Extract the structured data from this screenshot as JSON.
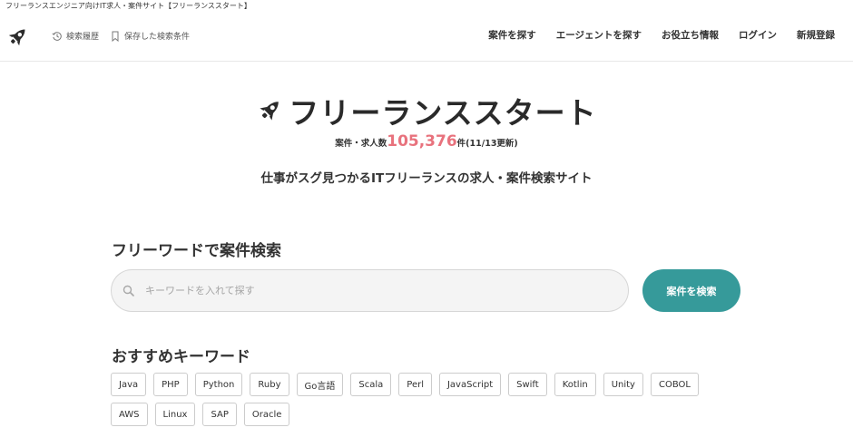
{
  "top_tagline": "フリーランスエンジニア向けIT求人・案件サイト【フリーランススタート】",
  "header": {
    "history_label": "検索履歴",
    "saved_label": "保存した検索条件",
    "nav": [
      "案件を探す",
      "エージェントを探す",
      "お役立ち情報",
      "ログイン",
      "新規登録"
    ]
  },
  "hero": {
    "brand_name": "フリーランススタート",
    "count_prefix": "案件・求人数",
    "count_value": "105,376",
    "count_suffix": "件(11/13更新)",
    "subtitle": "仕事がスグ見つかるITフリーランスの求人・案件検索サイト"
  },
  "search": {
    "section_title": "フリーワードで案件検索",
    "placeholder": "キーワードを入れて探す",
    "value": "",
    "button_label": "案件を検索"
  },
  "keywords": {
    "section_title": "おすすめキーワード",
    "row1": [
      "Java",
      "PHP",
      "Python",
      "Ruby",
      "Go言語",
      "Scala",
      "Perl",
      "JavaScript",
      "Swift",
      "Kotlin",
      "Unity",
      "COBOL"
    ],
    "row2": [
      "AWS",
      "Linux",
      "SAP",
      "Oracle"
    ]
  },
  "colors": {
    "accent_teal": "#369a9a",
    "count_pink": "#e8727d"
  }
}
